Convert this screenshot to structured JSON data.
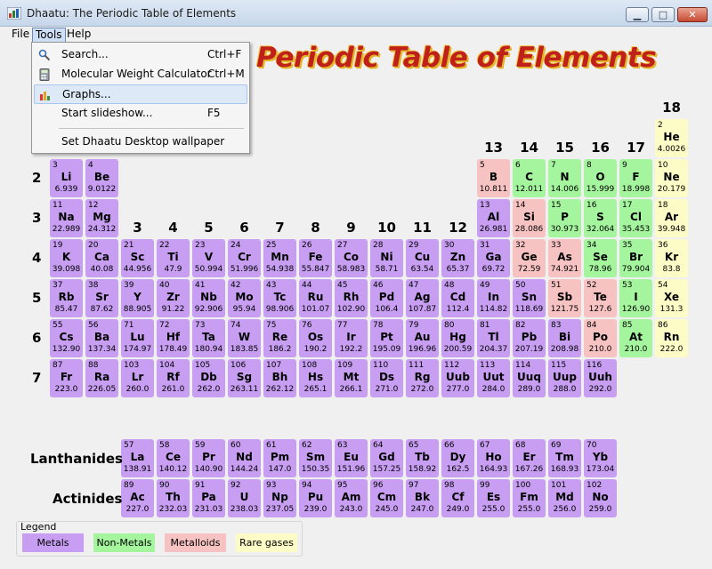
{
  "window": {
    "title": "Dhaatu: The Periodic Table of Elements"
  },
  "menubar": {
    "file": "File",
    "tools": "Tools",
    "help": "Help"
  },
  "tools_menu": {
    "items": [
      {
        "label": "Search...",
        "shortcut": "Ctrl+F",
        "icon": "search-icon"
      },
      {
        "label": "Molecular Weight Calculator",
        "shortcut": "Ctrl+M",
        "icon": "calculator-icon"
      },
      {
        "label": "Graphs...",
        "shortcut": "",
        "icon": "graph-icon",
        "highlighted": true
      },
      {
        "label": "Start slideshow...",
        "shortcut": "F5",
        "icon": ""
      },
      {
        "label": "Set Dhaatu Desktop wallpaper",
        "shortcut": "",
        "icon": ""
      }
    ]
  },
  "page": {
    "title": "Periodic Table of Elements"
  },
  "colors": {
    "metal": "#c79ef2",
    "nonmetal": "#a4f59e",
    "metalloid": "#f7c2c2",
    "raregas": "#fdfbc6",
    "title": "#c0201a"
  },
  "group_labels": [
    {
      "label": "3",
      "group": 3
    },
    {
      "label": "4",
      "group": 4
    },
    {
      "label": "5",
      "group": 5
    },
    {
      "label": "6",
      "group": 6
    },
    {
      "label": "7",
      "group": 7
    },
    {
      "label": "8",
      "group": 8
    },
    {
      "label": "9",
      "group": 9
    },
    {
      "label": "10",
      "group": 10
    },
    {
      "label": "11",
      "group": 11
    },
    {
      "label": "12",
      "group": 12
    },
    {
      "label": "13",
      "group": 13
    },
    {
      "label": "14",
      "group": 14
    },
    {
      "label": "15",
      "group": 15
    },
    {
      "label": "16",
      "group": 16
    },
    {
      "label": "17",
      "group": 17
    },
    {
      "label": "18",
      "group": 18
    }
  ],
  "period_labels": [
    {
      "label": "2",
      "period": 2
    },
    {
      "label": "3",
      "period": 3
    },
    {
      "label": "4",
      "period": 4
    },
    {
      "label": "5",
      "period": 5
    },
    {
      "label": "6",
      "period": 6
    },
    {
      "label": "7",
      "period": 7
    }
  ],
  "series_labels": {
    "lanthanides": "Lanthanides",
    "actinides": "Actinides"
  },
  "elements": [
    {
      "n": "2",
      "s": "He",
      "m": "4.0026",
      "p": 1,
      "g": 18,
      "c": "raregas"
    },
    {
      "n": "3",
      "s": "Li",
      "m": "6.939",
      "p": 2,
      "g": 1,
      "c": "metal"
    },
    {
      "n": "4",
      "s": "Be",
      "m": "9.0122",
      "p": 2,
      "g": 2,
      "c": "metal"
    },
    {
      "n": "5",
      "s": "B",
      "m": "10.811",
      "p": 2,
      "g": 13,
      "c": "metalloid"
    },
    {
      "n": "6",
      "s": "C",
      "m": "12.011",
      "p": 2,
      "g": 14,
      "c": "nonmetal"
    },
    {
      "n": "7",
      "s": "N",
      "m": "14.006",
      "p": 2,
      "g": 15,
      "c": "nonmetal"
    },
    {
      "n": "8",
      "s": "O",
      "m": "15.999",
      "p": 2,
      "g": 16,
      "c": "nonmetal"
    },
    {
      "n": "9",
      "s": "F",
      "m": "18.998",
      "p": 2,
      "g": 17,
      "c": "nonmetal"
    },
    {
      "n": "10",
      "s": "Ne",
      "m": "20.179",
      "p": 2,
      "g": 18,
      "c": "raregas"
    },
    {
      "n": "11",
      "s": "Na",
      "m": "22.989",
      "p": 3,
      "g": 1,
      "c": "metal"
    },
    {
      "n": "12",
      "s": "Mg",
      "m": "24.312",
      "p": 3,
      "g": 2,
      "c": "metal"
    },
    {
      "n": "13",
      "s": "Al",
      "m": "26.981",
      "p": 3,
      "g": 13,
      "c": "metal"
    },
    {
      "n": "14",
      "s": "Si",
      "m": "28.086",
      "p": 3,
      "g": 14,
      "c": "metalloid"
    },
    {
      "n": "15",
      "s": "P",
      "m": "30.973",
      "p": 3,
      "g": 15,
      "c": "nonmetal"
    },
    {
      "n": "16",
      "s": "S",
      "m": "32.064",
      "p": 3,
      "g": 16,
      "c": "nonmetal"
    },
    {
      "n": "17",
      "s": "Cl",
      "m": "35.453",
      "p": 3,
      "g": 17,
      "c": "nonmetal"
    },
    {
      "n": "18",
      "s": "Ar",
      "m": "39.948",
      "p": 3,
      "g": 18,
      "c": "raregas"
    },
    {
      "n": "19",
      "s": "K",
      "m": "39.098",
      "p": 4,
      "g": 1,
      "c": "metal"
    },
    {
      "n": "20",
      "s": "Ca",
      "m": "40.08",
      "p": 4,
      "g": 2,
      "c": "metal"
    },
    {
      "n": "21",
      "s": "Sc",
      "m": "44.956",
      "p": 4,
      "g": 3,
      "c": "metal"
    },
    {
      "n": "22",
      "s": "Ti",
      "m": "47.9",
      "p": 4,
      "g": 4,
      "c": "metal"
    },
    {
      "n": "23",
      "s": "V",
      "m": "50.994",
      "p": 4,
      "g": 5,
      "c": "metal"
    },
    {
      "n": "24",
      "s": "Cr",
      "m": "51.996",
      "p": 4,
      "g": 6,
      "c": "metal"
    },
    {
      "n": "25",
      "s": "Mn",
      "m": "54.938",
      "p": 4,
      "g": 7,
      "c": "metal"
    },
    {
      "n": "26",
      "s": "Fe",
      "m": "55.847",
      "p": 4,
      "g": 8,
      "c": "metal"
    },
    {
      "n": "27",
      "s": "Co",
      "m": "58.983",
      "p": 4,
      "g": 9,
      "c": "metal"
    },
    {
      "n": "28",
      "s": "Ni",
      "m": "58.71",
      "p": 4,
      "g": 10,
      "c": "metal"
    },
    {
      "n": "29",
      "s": "Cu",
      "m": "63.54",
      "p": 4,
      "g": 11,
      "c": "metal"
    },
    {
      "n": "30",
      "s": "Zn",
      "m": "65.37",
      "p": 4,
      "g": 12,
      "c": "metal"
    },
    {
      "n": "31",
      "s": "Ga",
      "m": "69.72",
      "p": 4,
      "g": 13,
      "c": "metal"
    },
    {
      "n": "32",
      "s": "Ge",
      "m": "72.59",
      "p": 4,
      "g": 14,
      "c": "metalloid"
    },
    {
      "n": "33",
      "s": "As",
      "m": "74.921",
      "p": 4,
      "g": 15,
      "c": "metalloid"
    },
    {
      "n": "34",
      "s": "Se",
      "m": "78.96",
      "p": 4,
      "g": 16,
      "c": "nonmetal"
    },
    {
      "n": "35",
      "s": "Br",
      "m": "79.904",
      "p": 4,
      "g": 17,
      "c": "nonmetal"
    },
    {
      "n": "36",
      "s": "Kr",
      "m": "83.8",
      "p": 4,
      "g": 18,
      "c": "raregas"
    },
    {
      "n": "37",
      "s": "Rb",
      "m": "85.47",
      "p": 5,
      "g": 1,
      "c": "metal"
    },
    {
      "n": "38",
      "s": "Sr",
      "m": "87.62",
      "p": 5,
      "g": 2,
      "c": "metal"
    },
    {
      "n": "39",
      "s": "Y",
      "m": "88.905",
      "p": 5,
      "g": 3,
      "c": "metal"
    },
    {
      "n": "40",
      "s": "Zr",
      "m": "91.22",
      "p": 5,
      "g": 4,
      "c": "metal"
    },
    {
      "n": "41",
      "s": "Nb",
      "m": "92.906",
      "p": 5,
      "g": 5,
      "c": "metal"
    },
    {
      "n": "42",
      "s": "Mo",
      "m": "95.94",
      "p": 5,
      "g": 6,
      "c": "metal"
    },
    {
      "n": "43",
      "s": "Tc",
      "m": "98.906",
      "p": 5,
      "g": 7,
      "c": "metal"
    },
    {
      "n": "44",
      "s": "Ru",
      "m": "101.07",
      "p": 5,
      "g": 8,
      "c": "metal"
    },
    {
      "n": "45",
      "s": "Rh",
      "m": "102.90",
      "p": 5,
      "g": 9,
      "c": "metal"
    },
    {
      "n": "46",
      "s": "Pd",
      "m": "106.4",
      "p": 5,
      "g": 10,
      "c": "metal"
    },
    {
      "n": "47",
      "s": "Ag",
      "m": "107.87",
      "p": 5,
      "g": 11,
      "c": "metal"
    },
    {
      "n": "48",
      "s": "Cd",
      "m": "112.4",
      "p": 5,
      "g": 12,
      "c": "metal"
    },
    {
      "n": "49",
      "s": "In",
      "m": "114.82",
      "p": 5,
      "g": 13,
      "c": "metal"
    },
    {
      "n": "50",
      "s": "Sn",
      "m": "118.69",
      "p": 5,
      "g": 14,
      "c": "metal"
    },
    {
      "n": "51",
      "s": "Sb",
      "m": "121.75",
      "p": 5,
      "g": 15,
      "c": "metalloid"
    },
    {
      "n": "52",
      "s": "Te",
      "m": "127.6",
      "p": 5,
      "g": 16,
      "c": "metalloid"
    },
    {
      "n": "53",
      "s": "I",
      "m": "126.90",
      "p": 5,
      "g": 17,
      "c": "nonmetal"
    },
    {
      "n": "54",
      "s": "Xe",
      "m": "131.3",
      "p": 5,
      "g": 18,
      "c": "raregas"
    },
    {
      "n": "55",
      "s": "Cs",
      "m": "132.90",
      "p": 6,
      "g": 1,
      "c": "metal"
    },
    {
      "n": "56",
      "s": "Ba",
      "m": "137.34",
      "p": 6,
      "g": 2,
      "c": "metal"
    },
    {
      "n": "71",
      "s": "Lu",
      "m": "174.97",
      "p": 6,
      "g": 3,
      "c": "metal"
    },
    {
      "n": "72",
      "s": "Hf",
      "m": "178.49",
      "p": 6,
      "g": 4,
      "c": "metal"
    },
    {
      "n": "73",
      "s": "Ta",
      "m": "180.94",
      "p": 6,
      "g": 5,
      "c": "metal"
    },
    {
      "n": "74",
      "s": "W",
      "m": "183.85",
      "p": 6,
      "g": 6,
      "c": "metal"
    },
    {
      "n": "75",
      "s": "Re",
      "m": "186.2",
      "p": 6,
      "g": 7,
      "c": "metal"
    },
    {
      "n": "76",
      "s": "Os",
      "m": "190.2",
      "p": 6,
      "g": 8,
      "c": "metal"
    },
    {
      "n": "77",
      "s": "Ir",
      "m": "192.2",
      "p": 6,
      "g": 9,
      "c": "metal"
    },
    {
      "n": "78",
      "s": "Pt",
      "m": "195.09",
      "p": 6,
      "g": 10,
      "c": "metal"
    },
    {
      "n": "79",
      "s": "Au",
      "m": "196.96",
      "p": 6,
      "g": 11,
      "c": "metal"
    },
    {
      "n": "80",
      "s": "Hg",
      "m": "200.59",
      "p": 6,
      "g": 12,
      "c": "metal"
    },
    {
      "n": "81",
      "s": "Tl",
      "m": "204.37",
      "p": 6,
      "g": 13,
      "c": "metal"
    },
    {
      "n": "82",
      "s": "Pb",
      "m": "207.19",
      "p": 6,
      "g": 14,
      "c": "metal"
    },
    {
      "n": "83",
      "s": "Bi",
      "m": "208.98",
      "p": 6,
      "g": 15,
      "c": "metal"
    },
    {
      "n": "84",
      "s": "Po",
      "m": "210.0",
      "p": 6,
      "g": 16,
      "c": "metalloid"
    },
    {
      "n": "85",
      "s": "At",
      "m": "210.0",
      "p": 6,
      "g": 17,
      "c": "nonmetal"
    },
    {
      "n": "86",
      "s": "Rn",
      "m": "222.0",
      "p": 6,
      "g": 18,
      "c": "raregas"
    },
    {
      "n": "87",
      "s": "Fr",
      "m": "223.0",
      "p": 7,
      "g": 1,
      "c": "metal"
    },
    {
      "n": "88",
      "s": "Ra",
      "m": "226.05",
      "p": 7,
      "g": 2,
      "c": "metal"
    },
    {
      "n": "103",
      "s": "Lr",
      "m": "260.0",
      "p": 7,
      "g": 3,
      "c": "metal"
    },
    {
      "n": "104",
      "s": "Rf",
      "m": "261.0",
      "p": 7,
      "g": 4,
      "c": "metal"
    },
    {
      "n": "105",
      "s": "Db",
      "m": "262.0",
      "p": 7,
      "g": 5,
      "c": "metal"
    },
    {
      "n": "106",
      "s": "Sg",
      "m": "263.11",
      "p": 7,
      "g": 6,
      "c": "metal"
    },
    {
      "n": "107",
      "s": "Bh",
      "m": "262.12",
      "p": 7,
      "g": 7,
      "c": "metal"
    },
    {
      "n": "108",
      "s": "Hs",
      "m": "265.1",
      "p": 7,
      "g": 8,
      "c": "metal"
    },
    {
      "n": "109",
      "s": "Mt",
      "m": "266.1",
      "p": 7,
      "g": 9,
      "c": "metal"
    },
    {
      "n": "110",
      "s": "Ds",
      "m": "271.0",
      "p": 7,
      "g": 10,
      "c": "metal"
    },
    {
      "n": "111",
      "s": "Rg",
      "m": "272.0",
      "p": 7,
      "g": 11,
      "c": "metal"
    },
    {
      "n": "112",
      "s": "Uub",
      "m": "277.0",
      "p": 7,
      "g": 12,
      "c": "metal"
    },
    {
      "n": "113",
      "s": "Uut",
      "m": "284.0",
      "p": 7,
      "g": 13,
      "c": "metal"
    },
    {
      "n": "114",
      "s": "Uuq",
      "m": "289.0",
      "p": 7,
      "g": 14,
      "c": "metal"
    },
    {
      "n": "115",
      "s": "Uup",
      "m": "288.0",
      "p": 7,
      "g": 15,
      "c": "metal"
    },
    {
      "n": "116",
      "s": "Uuh",
      "m": "292.0",
      "p": 7,
      "g": 16,
      "c": "metal"
    },
    {
      "n": "57",
      "s": "La",
      "m": "138.91",
      "p": 8,
      "g": 3,
      "c": "metal"
    },
    {
      "n": "58",
      "s": "Ce",
      "m": "140.12",
      "p": 8,
      "g": 4,
      "c": "metal"
    },
    {
      "n": "59",
      "s": "Pr",
      "m": "140.90",
      "p": 8,
      "g": 5,
      "c": "metal"
    },
    {
      "n": "60",
      "s": "Nd",
      "m": "144.24",
      "p": 8,
      "g": 6,
      "c": "metal"
    },
    {
      "n": "61",
      "s": "Pm",
      "m": "147.0",
      "p": 8,
      "g": 7,
      "c": "metal"
    },
    {
      "n": "62",
      "s": "Sm",
      "m": "150.35",
      "p": 8,
      "g": 8,
      "c": "metal"
    },
    {
      "n": "63",
      "s": "Eu",
      "m": "151.96",
      "p": 8,
      "g": 9,
      "c": "metal"
    },
    {
      "n": "64",
      "s": "Gd",
      "m": "157.25",
      "p": 8,
      "g": 10,
      "c": "metal"
    },
    {
      "n": "65",
      "s": "Tb",
      "m": "158.92",
      "p": 8,
      "g": 11,
      "c": "metal"
    },
    {
      "n": "66",
      "s": "Dy",
      "m": "162.5",
      "p": 8,
      "g": 12,
      "c": "metal"
    },
    {
      "n": "67",
      "s": "Ho",
      "m": "164.93",
      "p": 8,
      "g": 13,
      "c": "metal"
    },
    {
      "n": "68",
      "s": "Er",
      "m": "167.26",
      "p": 8,
      "g": 14,
      "c": "metal"
    },
    {
      "n": "69",
      "s": "Tm",
      "m": "168.93",
      "p": 8,
      "g": 15,
      "c": "metal"
    },
    {
      "n": "70",
      "s": "Yb",
      "m": "173.04",
      "p": 8,
      "g": 16,
      "c": "metal"
    },
    {
      "n": "89",
      "s": "Ac",
      "m": "227.0",
      "p": 9,
      "g": 3,
      "c": "metal"
    },
    {
      "n": "90",
      "s": "Th",
      "m": "232.03",
      "p": 9,
      "g": 4,
      "c": "metal"
    },
    {
      "n": "91",
      "s": "Pa",
      "m": "231.03",
      "p": 9,
      "g": 5,
      "c": "metal"
    },
    {
      "n": "92",
      "s": "U",
      "m": "238.03",
      "p": 9,
      "g": 6,
      "c": "metal"
    },
    {
      "n": "93",
      "s": "Np",
      "m": "237.05",
      "p": 9,
      "g": 7,
      "c": "metal"
    },
    {
      "n": "94",
      "s": "Pu",
      "m": "239.0",
      "p": 9,
      "g": 8,
      "c": "metal"
    },
    {
      "n": "95",
      "s": "Am",
      "m": "243.0",
      "p": 9,
      "g": 9,
      "c": "metal"
    },
    {
      "n": "96",
      "s": "Cm",
      "m": "245.0",
      "p": 9,
      "g": 10,
      "c": "metal"
    },
    {
      "n": "97",
      "s": "Bk",
      "m": "247.0",
      "p": 9,
      "g": 11,
      "c": "metal"
    },
    {
      "n": "98",
      "s": "Cf",
      "m": "249.0",
      "p": 9,
      "g": 12,
      "c": "metal"
    },
    {
      "n": "99",
      "s": "Es",
      "m": "255.0",
      "p": 9,
      "g": 13,
      "c": "metal"
    },
    {
      "n": "100",
      "s": "Fm",
      "m": "255.0",
      "p": 9,
      "g": 14,
      "c": "metal"
    },
    {
      "n": "101",
      "s": "Md",
      "m": "256.0",
      "p": 9,
      "g": 15,
      "c": "metal"
    },
    {
      "n": "102",
      "s": "No",
      "m": "259.0",
      "p": 9,
      "g": 16,
      "c": "metal"
    }
  ],
  "legend": {
    "title": "Legend",
    "items": [
      {
        "label": "Metals",
        "category": "metal"
      },
      {
        "label": "Non-Metals",
        "category": "nonmetal"
      },
      {
        "label": "Metalloids",
        "category": "metalloid"
      },
      {
        "label": "Rare gases",
        "category": "raregas"
      }
    ]
  }
}
